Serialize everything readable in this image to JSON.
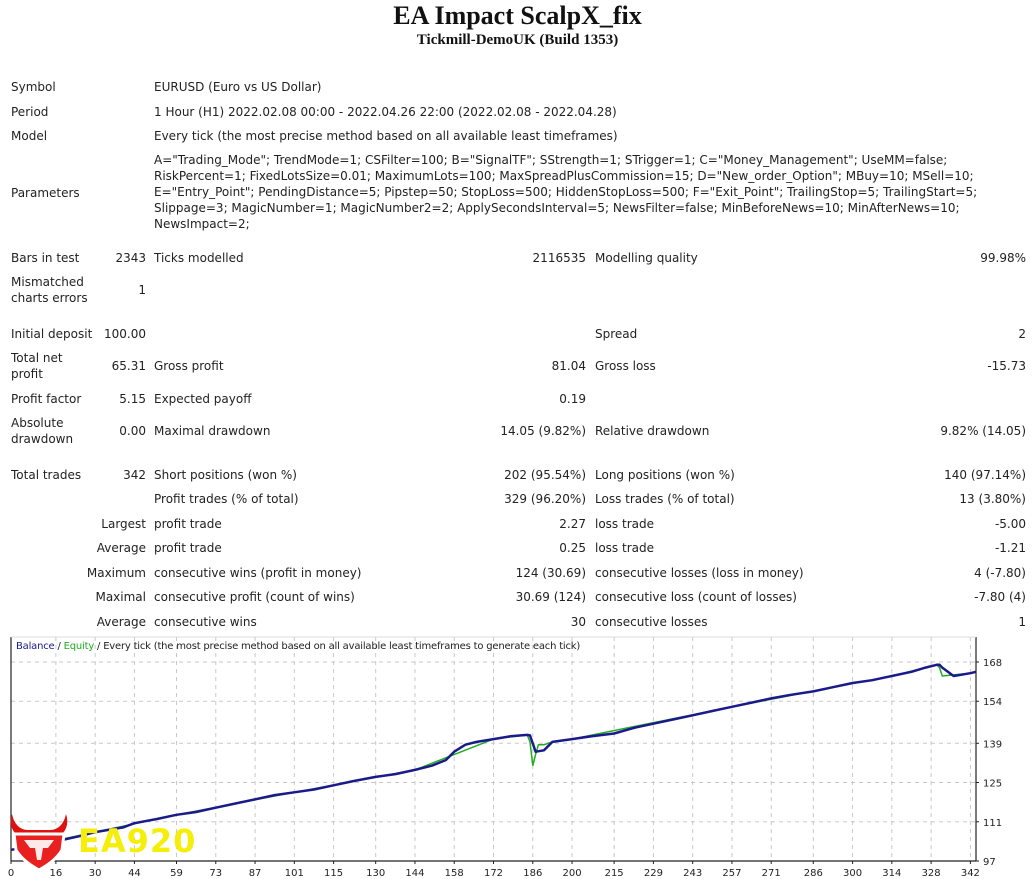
{
  "header": {
    "title": "EA Impact ScalpX_fix",
    "subtitle": "Tickmill-DemoUK (Build 1353)"
  },
  "info": {
    "symbol_label": "Symbol",
    "symbol_value": "EURUSD (Euro vs US Dollar)",
    "period_label": "Period",
    "period_value": "1 Hour (H1) 2022.02.08 00:00 - 2022.04.26 22:00 (2022.02.08 - 2022.04.28)",
    "model_label": "Model",
    "model_value": "Every tick (the most precise method based on all available least timeframes)",
    "parameters_label": "Parameters",
    "parameters_lines": [
      "A=\"Trading_Mode\"; TrendMode=1; CSFilter=100; B=\"SignalTF\"; SStrength=1; STrigger=1; C=\"Money_Management\"; UseMM=false;",
      "RiskPercent=1; FixedLotsSize=0.01; MaximumLots=100; MaxSpreadPlusCommission=15; D=\"New_order_Option\"; MBuy=10; MSell=10;",
      "E=\"Entry_Point\"; PendingDistance=5; Pipstep=50; StopLoss=500; HiddenStopLoss=500; F=\"Exit_Point\"; TrailingStop=5; TrailingStart=5;",
      "Slippage=3; MagicNumber=1; MagicNumber2=2; ApplySecondsInterval=5; NewsFilter=false; MinBeforeNews=10; MinAfterNews=10;",
      "NewsImpact=2;"
    ]
  },
  "stats": {
    "bars_label": "Bars in test",
    "bars_value": "2343",
    "ticks_label": "Ticks modelled",
    "ticks_value": "2116535",
    "quality_label": "Modelling quality",
    "quality_value": "99.98%",
    "mismatched_label_1": "Mismatched",
    "mismatched_label_2": "charts errors",
    "mismatched_value": "1",
    "deposit_label": "Initial deposit",
    "deposit_value": "100.00",
    "spread_label": "Spread",
    "spread_value": "2",
    "netprofit_label_1": "Total net",
    "netprofit_label_2": "profit",
    "netprofit_value": "65.31",
    "grossprofit_label": "Gross profit",
    "grossprofit_value": "81.04",
    "grossloss_label": "Gross loss",
    "grossloss_value": "-15.73",
    "pf_label": "Profit factor",
    "pf_value": "5.15",
    "payoff_label": "Expected payoff",
    "payoff_value": "0.19",
    "absdd_label_1": "Absolute",
    "absdd_label_2": "drawdown",
    "absdd_value": "0.00",
    "maxdd_label": "Maximal drawdown",
    "maxdd_value": "14.05 (9.82%)",
    "reldd_label": "Relative drawdown",
    "reldd_value": "9.82% (14.05)",
    "trades_label": "Total trades",
    "trades_value": "342",
    "short_label": "Short positions (won %)",
    "short_value": "202 (95.54%)",
    "long_label": "Long positions (won %)",
    "long_value": "140 (97.14%)",
    "profittrades_label": "Profit trades (% of total)",
    "profittrades_value": "329 (96.20%)",
    "losstrades_label": "Loss trades (% of total)",
    "losstrades_value": "13 (3.80%)",
    "rows": [
      {
        "prefix": "Largest",
        "a_label": "profit trade",
        "a_value": "2.27",
        "b_label": "loss trade",
        "b_value": "-5.00"
      },
      {
        "prefix": "Average",
        "a_label": "profit trade",
        "a_value": "0.25",
        "b_label": "loss trade",
        "b_value": "-1.21"
      },
      {
        "prefix": "Maximum",
        "a_label": "consecutive wins (profit in money)",
        "a_value": "124 (30.69)",
        "b_label": "consecutive losses (loss in money)",
        "b_value": "4 (-7.80)"
      },
      {
        "prefix": "Maximal",
        "a_label": "consecutive profit (count of wins)",
        "a_value": "30.69 (124)",
        "b_label": "consecutive loss (count of losses)",
        "b_value": "-7.80 (4)"
      },
      {
        "prefix": "Average",
        "a_label": "consecutive wins",
        "a_value": "30",
        "b_label": "consecutive losses",
        "b_value": "1"
      }
    ]
  },
  "chart_legend": {
    "balance": "Balance",
    "sep1": " / ",
    "equity": "Equity",
    "sep2": " / ",
    "desc": "Every tick (the most precise method based on all available least timeframes to generate each tick)"
  },
  "watermark": {
    "text": "EA920"
  },
  "chart_data": {
    "type": "line",
    "title": "Balance / Equity / Every tick (the most precise method based on all available least timeframes to generate each tick)",
    "xlabel": "",
    "ylabel": "",
    "x_ticks": [
      "0",
      "16",
      "30",
      "44",
      "59",
      "73",
      "87",
      "101",
      "115",
      "130",
      "144",
      "158",
      "172",
      "186",
      "200",
      "215",
      "229",
      "243",
      "257",
      "271",
      "286",
      "300",
      "314",
      "328",
      "342"
    ],
    "y_ticks": [
      "97",
      "111",
      "125",
      "139",
      "154",
      "168"
    ],
    "xlim": [
      0,
      344
    ],
    "ylim": [
      97,
      175
    ],
    "grid": true,
    "legend": "top-left",
    "colors": {
      "balance": "#1a1a8c",
      "equity": "#22aa22"
    },
    "series": [
      {
        "name": "Balance",
        "x": [
          0,
          8,
          16,
          25,
          30,
          40,
          44,
          52,
          59,
          66,
          73,
          80,
          87,
          94,
          101,
          108,
          115,
          122,
          130,
          137,
          144,
          150,
          155,
          158,
          162,
          166,
          172,
          178,
          184,
          185,
          187,
          190,
          193,
          200,
          207,
          215,
          222,
          229,
          236,
          243,
          250,
          257,
          264,
          271,
          278,
          286,
          293,
          300,
          307,
          314,
          321,
          326,
          330,
          331,
          332,
          336,
          342,
          344
        ],
        "y": [
          101,
          102.2,
          104,
          106,
          107.3,
          109,
          110.5,
          112,
          113.5,
          114.5,
          116,
          117.5,
          119,
          120.5,
          121.5,
          122.5,
          124,
          125.5,
          127,
          128,
          129.5,
          131,
          133,
          136,
          138.5,
          139.5,
          140.5,
          141.5,
          142,
          141.8,
          136,
          136.5,
          139.5,
          140.5,
          141.5,
          142.5,
          144.5,
          146,
          147.5,
          149,
          150.5,
          152,
          153.5,
          155,
          156.3,
          157.5,
          159,
          160.5,
          161.5,
          163,
          164.5,
          166,
          167,
          167,
          166,
          163,
          164,
          164.5
        ]
      },
      {
        "name": "Equity",
        "x": [
          0,
          30,
          59,
          101,
          144,
          172,
          184,
          185,
          186,
          187,
          188,
          190,
          193,
          200,
          257,
          314,
          330,
          331,
          332,
          342,
          344
        ],
        "y": [
          101,
          107.3,
          113.5,
          121.5,
          129.5,
          140.5,
          142,
          139.5,
          131,
          135,
          138.5,
          138.5,
          139.5,
          140.5,
          152,
          163,
          167,
          166,
          163,
          164,
          164.5
        ]
      }
    ]
  }
}
